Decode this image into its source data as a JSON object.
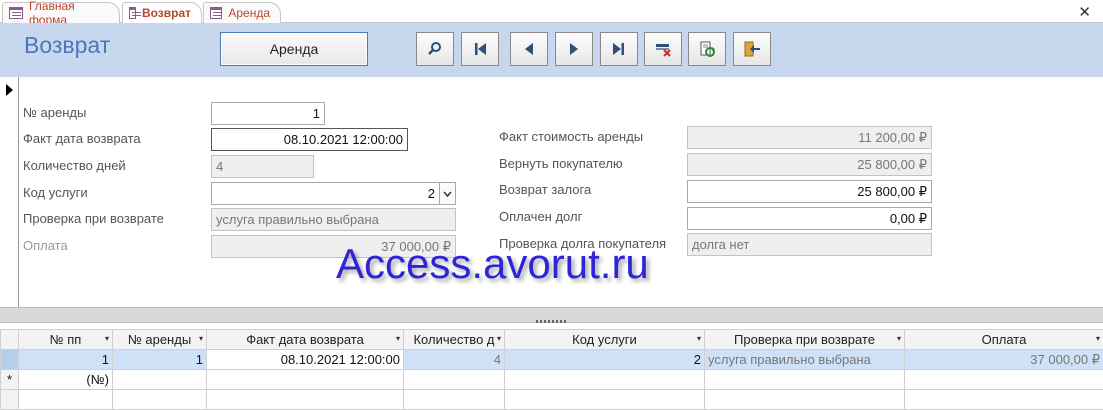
{
  "tabs": [
    {
      "label": "Главная форма",
      "active": false
    },
    {
      "label": "Возврат",
      "active": true
    },
    {
      "label": "Аренда",
      "active": false
    }
  ],
  "header": {
    "title": "Возврат",
    "rent_button": "Аренда",
    "nav_buttons": [
      "search-icon",
      "first-record-icon",
      "previous-record-icon",
      "next-record-icon",
      "last-record-icon",
      "delete-record-icon",
      "refresh-icon",
      "exit-icon"
    ]
  },
  "form": {
    "left": {
      "rent_no": {
        "label": "№ аренды",
        "value": "1"
      },
      "return_date": {
        "label": "Факт дата возврата",
        "value": "08.10.2021 12:00:00"
      },
      "days": {
        "label": "Количество дней",
        "value": "4"
      },
      "service_code": {
        "label": "Код услуги",
        "value": "2"
      },
      "check_return": {
        "label": "Проверка при возврате",
        "value": "услуга правильно выбрана"
      },
      "payment": {
        "label": "Оплата",
        "value": "37 000,00 ₽"
      }
    },
    "right": {
      "rent_cost": {
        "label": "Факт стоимость аренды",
        "value": "11 200,00 ₽"
      },
      "refund": {
        "label": "Вернуть покупателю",
        "value": "25 800,00 ₽"
      },
      "deposit_return": {
        "label": "Возврат залога",
        "value": "25 800,00 ₽"
      },
      "debt_paid": {
        "label": "Оплачен долг",
        "value": "0,00 ₽"
      },
      "debt_check": {
        "label": "Проверка долга покупателя",
        "value": "долга нет"
      }
    }
  },
  "watermark": "Access.avorut.ru",
  "grid": {
    "columns": [
      "№ пп",
      "№ аренды",
      "Факт дата возврата",
      "Количество д",
      "Код услуги",
      "Проверка при возврате",
      "Оплата"
    ],
    "rows": [
      [
        "1",
        "1",
        "08.10.2021 12:00:00",
        "4",
        "2",
        "услуга правильно выбрана",
        "37 000,00 ₽"
      ]
    ],
    "new_row_marker": "*",
    "new_row_placeholder": "(№)"
  },
  "colors": {
    "accent": "#4a78b8",
    "header_bg": "#c7d8ee",
    "tab_text": "#b7472a",
    "watermark": "#2e25d6"
  }
}
